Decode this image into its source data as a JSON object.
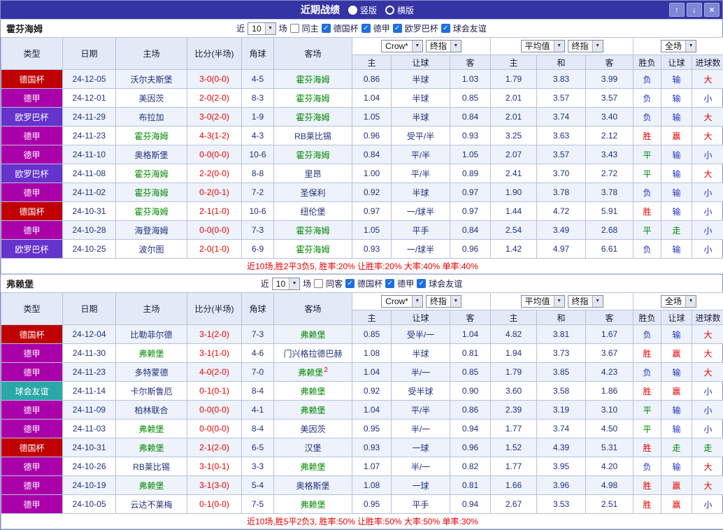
{
  "title_bar": {
    "title": "近期战绩",
    "view_options": [
      {
        "label": "竖版",
        "selected": true
      },
      {
        "label": "横版",
        "selected": false
      }
    ],
    "buttons": {
      "up": "↑",
      "down": "↓",
      "close": "×"
    }
  },
  "columns": {
    "main": [
      "类型",
      "日期",
      "主场",
      "比分(半场)",
      "角球",
      "客场"
    ],
    "sub": [
      "主",
      "让球",
      "客",
      "主",
      "和",
      "客",
      "胜负",
      "让球",
      "进球数"
    ]
  },
  "colors": {
    "titlebar_bg": "#3434A4",
    "header_bg": "#E3E9F6",
    "row_alt_bg": "#EDF2FB",
    "border": "#B7C2DE",
    "score_text": "#E60000",
    "focus_team_text": "#008800",
    "data_text": "#20307E",
    "summary_text": "#E60000",
    "type_colors": {
      "德国杯": "#C00000",
      "德甲": "#AA00AA",
      "欧罗巴杯": "#6633CC",
      "球会友谊": "#2AA8A8"
    },
    "result_colors": {
      "胜": "#E60000",
      "赢": "#E60000",
      "大": "#E60000",
      "平": "#008800",
      "走": "#008800",
      "负": "#2233BB",
      "输": "#2233BB",
      "小": "#2233BB"
    }
  },
  "sections": [
    {
      "team": "霍芬海姆",
      "filter": {
        "prefix": "近",
        "count": "10",
        "suffix": "场",
        "same": {
          "label": "同主",
          "checked": false
        },
        "competitions": [
          {
            "label": "德国杯",
            "checked": true
          },
          {
            "label": "德甲",
            "checked": true
          },
          {
            "label": "欧罗巴杯",
            "checked": true
          },
          {
            "label": "球会友谊",
            "checked": true
          }
        ]
      },
      "selects": {
        "odds_provider": "Crow*",
        "odds_kind": "终指",
        "average": "平均值",
        "average_kind": "终指",
        "scope": "全场"
      },
      "rows": [
        {
          "type": "德国杯",
          "date": "24-12-05",
          "home": "沃尔夫斯堡",
          "score": "3-0(0-0)",
          "corner": "4-5",
          "away": "霍芬海姆",
          "focus": "away",
          "card": "",
          "odds": [
            "0.86",
            "半球",
            "1.03"
          ],
          "avg": [
            "1.79",
            "3.83",
            "3.99"
          ],
          "res": [
            "负",
            "输",
            "大"
          ]
        },
        {
          "type": "德甲",
          "date": "24-12-01",
          "home": "美因茨",
          "score": "2-0(2-0)",
          "corner": "8-3",
          "away": "霍芬海姆",
          "focus": "away",
          "card": "",
          "odds": [
            "1.04",
            "半球",
            "0.85"
          ],
          "avg": [
            "2.01",
            "3.57",
            "3.57"
          ],
          "res": [
            "负",
            "输",
            "小"
          ]
        },
        {
          "type": "欧罗巴杯",
          "date": "24-11-29",
          "home": "布拉加",
          "score": "3-0(2-0)",
          "corner": "1-9",
          "away": "霍芬海姆",
          "focus": "away",
          "card": "",
          "odds": [
            "1.05",
            "半球",
            "0.84"
          ],
          "avg": [
            "2.01",
            "3.74",
            "3.40"
          ],
          "res": [
            "负",
            "输",
            "大"
          ]
        },
        {
          "type": "德甲",
          "date": "24-11-23",
          "home": "霍芬海姆",
          "score": "4-3(1-2)",
          "corner": "4-3",
          "away": "RB莱比锡",
          "focus": "home",
          "card": "",
          "odds": [
            "0.96",
            "受平/半",
            "0.93"
          ],
          "avg": [
            "3.25",
            "3.63",
            "2.12"
          ],
          "res": [
            "胜",
            "赢",
            "大"
          ]
        },
        {
          "type": "德甲",
          "date": "24-11-10",
          "home": "奥格斯堡",
          "score": "0-0(0-0)",
          "corner": "10-6",
          "away": "霍芬海姆",
          "focus": "away",
          "card": "",
          "odds": [
            "0.84",
            "平/半",
            "1.05"
          ],
          "avg": [
            "2.07",
            "3.57",
            "3.43"
          ],
          "res": [
            "平",
            "输",
            "小"
          ]
        },
        {
          "type": "欧罗巴杯",
          "date": "24-11-08",
          "home": "霍芬海姆",
          "score": "2-2(0-0)",
          "corner": "8-8",
          "away": "里昂",
          "focus": "home",
          "card": "",
          "odds": [
            "1.00",
            "平/半",
            "0.89"
          ],
          "avg": [
            "2.41",
            "3.70",
            "2.72"
          ],
          "res": [
            "平",
            "输",
            "大"
          ]
        },
        {
          "type": "德甲",
          "date": "24-11-02",
          "home": "霍芬海姆",
          "score": "0-2(0-1)",
          "corner": "7-2",
          "away": "圣保利",
          "focus": "home",
          "card": "",
          "odds": [
            "0.92",
            "半球",
            "0.97"
          ],
          "avg": [
            "1.90",
            "3.78",
            "3.78"
          ],
          "res": [
            "负",
            "输",
            "小"
          ]
        },
        {
          "type": "德国杯",
          "date": "24-10-31",
          "home": "霍芬海姆",
          "score": "2-1(1-0)",
          "corner": "10-6",
          "away": "纽伦堡",
          "focus": "home",
          "card": "",
          "odds": [
            "0.97",
            "一/球半",
            "0.97"
          ],
          "avg": [
            "1.44",
            "4.72",
            "5.91"
          ],
          "res": [
            "胜",
            "输",
            "小"
          ]
        },
        {
          "type": "德甲",
          "date": "24-10-28",
          "home": "海登海姆",
          "score": "0-0(0-0)",
          "corner": "7-3",
          "away": "霍芬海姆",
          "focus": "away",
          "card": "",
          "odds": [
            "1.05",
            "平手",
            "0.84"
          ],
          "avg": [
            "2.54",
            "3.49",
            "2.68"
          ],
          "res": [
            "平",
            "走",
            "小"
          ]
        },
        {
          "type": "欧罗巴杯",
          "date": "24-10-25",
          "home": "波尔图",
          "score": "2-0(1-0)",
          "corner": "6-9",
          "away": "霍芬海姆",
          "focus": "away",
          "card": "",
          "odds": [
            "0.93",
            "一/球半",
            "0.96"
          ],
          "avg": [
            "1.42",
            "4.97",
            "6.61"
          ],
          "res": [
            "负",
            "输",
            "小"
          ]
        }
      ],
      "summary": "近10场,胜2平3负5, 胜率:20% 让胜率:20% 大率:40% 单率:40%"
    },
    {
      "team": "弗赖堡",
      "filter": {
        "prefix": "近",
        "count": "10",
        "suffix": "场",
        "same": {
          "label": "同客",
          "checked": false
        },
        "competitions": [
          {
            "label": "德国杯",
            "checked": true
          },
          {
            "label": "德甲",
            "checked": true
          },
          {
            "label": "球会友谊",
            "checked": true
          }
        ]
      },
      "selects": {
        "odds_provider": "Crow*",
        "odds_kind": "终指",
        "average": "平均值",
        "average_kind": "终指",
        "scope": "全场"
      },
      "rows": [
        {
          "type": "德国杯",
          "date": "24-12-04",
          "home": "比勒菲尔德",
          "score": "3-1(2-0)",
          "corner": "7-3",
          "away": "弗赖堡",
          "focus": "away",
          "card": "",
          "odds": [
            "0.85",
            "受半/一",
            "1.04"
          ],
          "avg": [
            "4.82",
            "3.81",
            "1.67"
          ],
          "res": [
            "负",
            "输",
            "大"
          ]
        },
        {
          "type": "德甲",
          "date": "24-11-30",
          "home": "弗赖堡",
          "score": "3-1(1-0)",
          "corner": "4-6",
          "away": "门兴格拉德巴赫",
          "focus": "home",
          "card": "",
          "odds": [
            "1.08",
            "半球",
            "0.81"
          ],
          "avg": [
            "1.94",
            "3.73",
            "3.67"
          ],
          "res": [
            "胜",
            "赢",
            "大"
          ]
        },
        {
          "type": "德甲",
          "date": "24-11-23",
          "home": "多特蒙德",
          "score": "4-0(2-0)",
          "corner": "7-0",
          "away": "弗赖堡",
          "focus": "away",
          "card": "2",
          "odds": [
            "1.04",
            "半/一",
            "0.85"
          ],
          "avg": [
            "1.79",
            "3.85",
            "4.23"
          ],
          "res": [
            "负",
            "输",
            "大"
          ]
        },
        {
          "type": "球会友谊",
          "date": "24-11-14",
          "home": "卡尔斯鲁厄",
          "score": "0-1(0-1)",
          "corner": "8-4",
          "away": "弗赖堡",
          "focus": "away",
          "card": "",
          "odds": [
            "0.92",
            "受半球",
            "0.90"
          ],
          "avg": [
            "3.60",
            "3.58",
            "1.86"
          ],
          "res": [
            "胜",
            "赢",
            "小"
          ]
        },
        {
          "type": "德甲",
          "date": "24-11-09",
          "home": "柏林联合",
          "score": "0-0(0-0)",
          "corner": "4-1",
          "away": "弗赖堡",
          "focus": "away",
          "card": "",
          "odds": [
            "1.04",
            "平/半",
            "0.86"
          ],
          "avg": [
            "2.39",
            "3.19",
            "3.10"
          ],
          "res": [
            "平",
            "输",
            "小"
          ]
        },
        {
          "type": "德甲",
          "date": "24-11-03",
          "home": "弗赖堡",
          "score": "0-0(0-0)",
          "corner": "8-4",
          "away": "美因茨",
          "focus": "home",
          "card": "",
          "odds": [
            "0.95",
            "半/一",
            "0.94"
          ],
          "avg": [
            "1.77",
            "3.74",
            "4.50"
          ],
          "res": [
            "平",
            "输",
            "小"
          ]
        },
        {
          "type": "德国杯",
          "date": "24-10-31",
          "home": "弗赖堡",
          "score": "2-1(2-0)",
          "corner": "6-5",
          "away": "汉堡",
          "focus": "home",
          "card": "",
          "odds": [
            "0.93",
            "一球",
            "0.96"
          ],
          "avg": [
            "1.52",
            "4.39",
            "5.31"
          ],
          "res": [
            "胜",
            "走",
            "走"
          ]
        },
        {
          "type": "德甲",
          "date": "24-10-26",
          "home": "RB莱比锡",
          "score": "3-1(0-1)",
          "corner": "3-3",
          "away": "弗赖堡",
          "focus": "away",
          "card": "",
          "odds": [
            "1.07",
            "半/一",
            "0.82"
          ],
          "avg": [
            "1.77",
            "3.95",
            "4.20"
          ],
          "res": [
            "负",
            "输",
            "大"
          ]
        },
        {
          "type": "德甲",
          "date": "24-10-19",
          "home": "弗赖堡",
          "score": "3-1(3-0)",
          "corner": "5-4",
          "away": "奥格斯堡",
          "focus": "home",
          "card": "",
          "odds": [
            "1.08",
            "一球",
            "0.81"
          ],
          "avg": [
            "1.66",
            "3.96",
            "4.98"
          ],
          "res": [
            "胜",
            "赢",
            "大"
          ]
        },
        {
          "type": "德甲",
          "date": "24-10-05",
          "home": "云达不莱梅",
          "score": "0-1(0-0)",
          "corner": "7-5",
          "away": "弗赖堡",
          "focus": "away",
          "card": "",
          "odds": [
            "0.95",
            "平手",
            "0.94"
          ],
          "avg": [
            "2.67",
            "3.53",
            "2.51"
          ],
          "res": [
            "胜",
            "赢",
            "小"
          ]
        }
      ],
      "summary": "近10场,胜5平2负3, 胜率:50% 让胜率:50% 大率:50% 单率:30%"
    }
  ]
}
